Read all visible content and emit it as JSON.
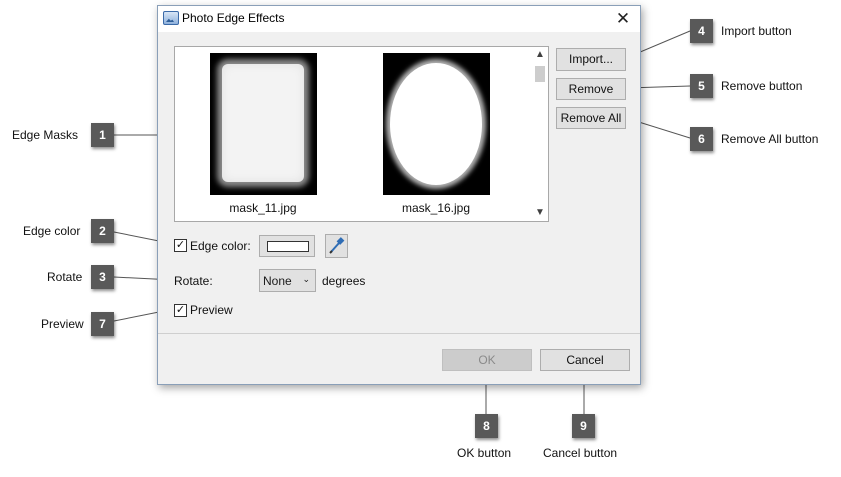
{
  "dialog": {
    "title": "Photo Edge Effects",
    "close_glyph": "✕",
    "masks": [
      {
        "caption": "mask_11.jpg",
        "shape": "rectangle"
      },
      {
        "caption": "mask_16.jpg",
        "shape": "oval"
      }
    ],
    "buttons": {
      "import": "Import...",
      "remove": "Remove",
      "remove_all": "Remove All",
      "ok": "OK",
      "cancel": "Cancel"
    },
    "edge_color": {
      "label": "Edge color:",
      "checked": true,
      "swatch_color": "#ffffff"
    },
    "rotate": {
      "label": "Rotate:",
      "value": "None",
      "suffix": "degrees"
    },
    "preview": {
      "label": "Preview",
      "checked": true
    }
  },
  "callouts": [
    {
      "number": "1",
      "text": "Edge Masks"
    },
    {
      "number": "2",
      "text": "Edge color"
    },
    {
      "number": "3",
      "text": "Rotate"
    },
    {
      "number": "4",
      "text": "Import button"
    },
    {
      "number": "5",
      "text": "Remove button"
    },
    {
      "number": "6",
      "text": "Remove All button"
    },
    {
      "number": "7",
      "text": "Preview"
    },
    {
      "number": "8",
      "text": "OK button"
    },
    {
      "number": "9",
      "text": "Cancel button"
    }
  ],
  "colors": {
    "badge": "#595959",
    "dialog_background": "#f0f0f0",
    "button_face": "#e1e1e1"
  }
}
